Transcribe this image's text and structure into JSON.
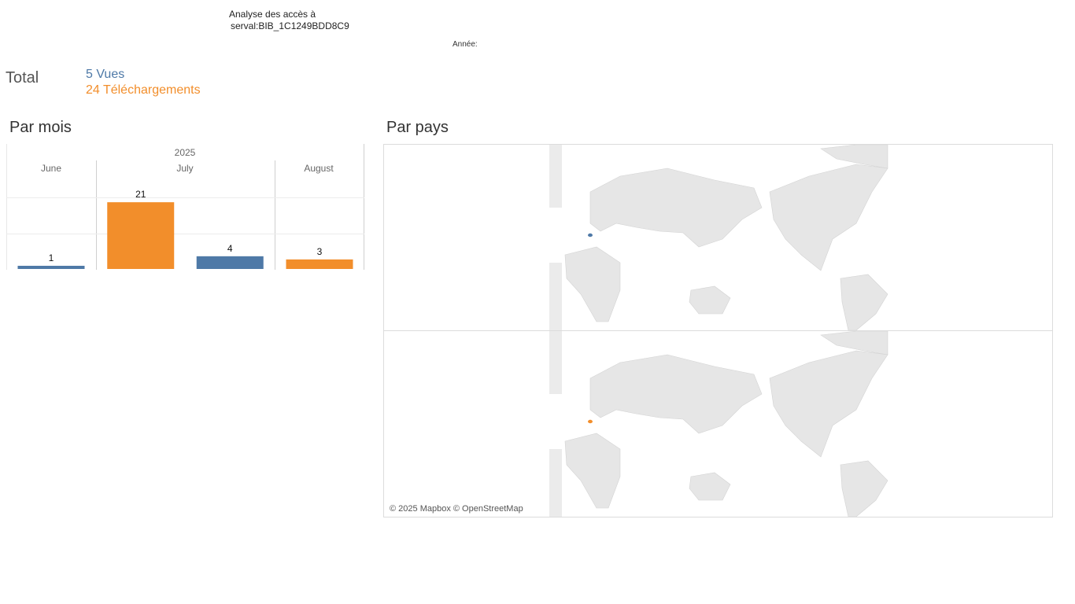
{
  "header": {
    "title_line1": "Analyse des accès à",
    "title_line2": "serval:BIB_1C1249BDD8C9",
    "year_filter_label": "Année:"
  },
  "totals": {
    "label": "Total",
    "views": "5 Vues",
    "downloads": "24 Téléchargements"
  },
  "sections": {
    "by_month": "Par mois",
    "by_country": "Par pays"
  },
  "map": {
    "credit": "© 2025 Mapbox © OpenStreetMap",
    "highlight_colors": {
      "views": "#4e79a7",
      "downloads": "#f28e2b"
    }
  },
  "colors": {
    "views": "#4e79a7",
    "downloads": "#f28e2b"
  },
  "chart_data": {
    "type": "bar",
    "year": "2025",
    "categories": [
      "June",
      "July",
      "August"
    ],
    "bars": [
      {
        "month": "June",
        "series": "Vues",
        "value": 1
      },
      {
        "month": "July",
        "series": "Téléchargements",
        "value": 21
      },
      {
        "month": "July",
        "series": "Vues",
        "value": 4
      },
      {
        "month": "August",
        "series": "Téléchargements",
        "value": 3
      }
    ],
    "series": [
      {
        "name": "Vues",
        "color": "#4e79a7"
      },
      {
        "name": "Téléchargements",
        "color": "#f28e2b"
      }
    ],
    "ylim": [
      0,
      24.5
    ],
    "grid": true
  }
}
